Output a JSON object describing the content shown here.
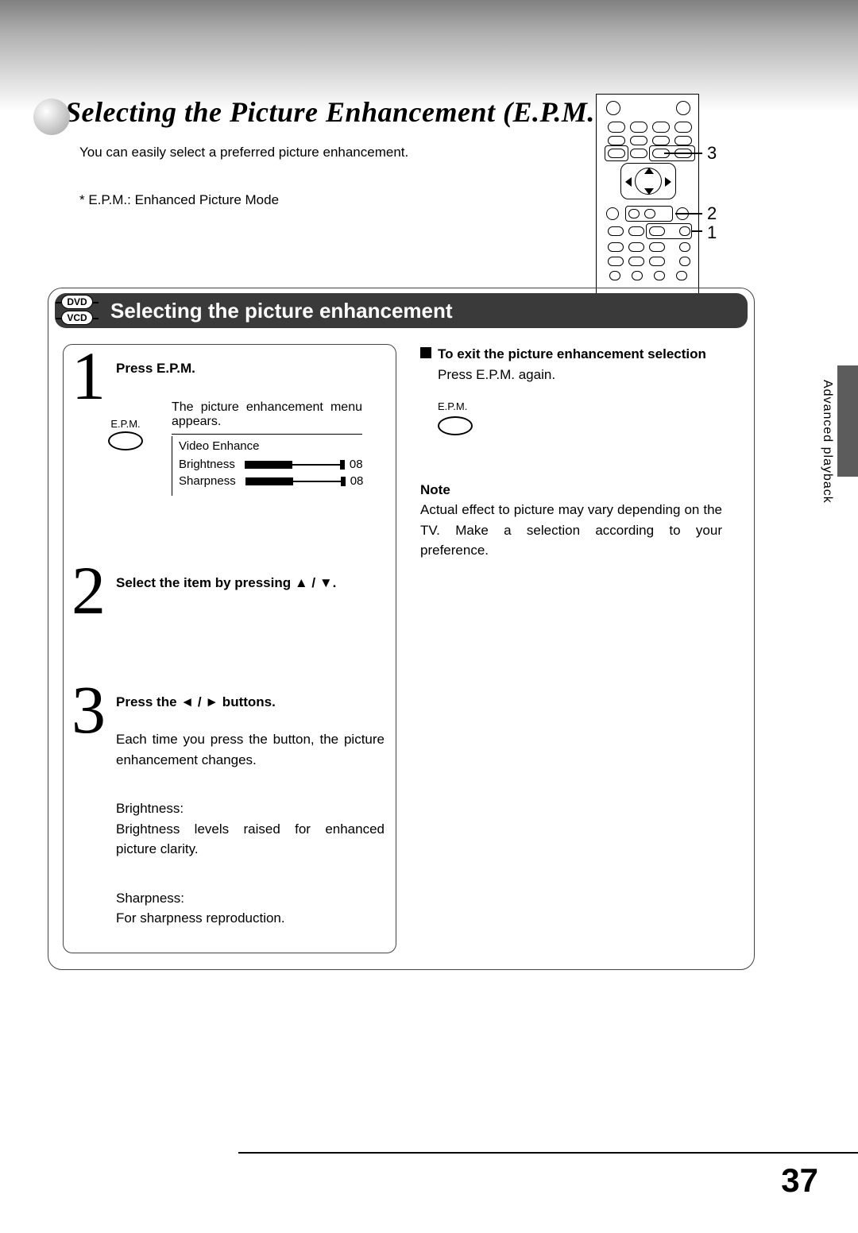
{
  "header": {
    "title": "Selecting the Picture Enhancement (E.P.M.*)",
    "intro": "You can easily select a preferred picture enhancement.",
    "footnote": "* E.P.M.: Enhanced Picture Mode"
  },
  "remote_callouts": [
    "3",
    "2",
    "1"
  ],
  "section": {
    "badges": [
      "DVD",
      "VCD"
    ],
    "title": "Selecting the picture enhancement",
    "steps": [
      {
        "num": "1",
        "title": "Press E.P.M.",
        "desc": "The picture enhancement menu appears.",
        "button_label": "E.P.M.",
        "osd": {
          "title": "Video Enhance",
          "rows": [
            {
              "label": "Brightness",
              "value": "08",
              "fill_pct": 50
            },
            {
              "label": "Sharpness",
              "value": "08",
              "fill_pct": 50
            }
          ]
        }
      },
      {
        "num": "2",
        "title": "Select the item by pressing ▲ / ▼."
      },
      {
        "num": "3",
        "title": "Press the ◄ / ► buttons.",
        "desc": "Each time you press the button, the picture enhancement changes.",
        "brightness_label": "Brightness:",
        "brightness_text": "Brightness levels raised for enhanced picture clarity.",
        "sharpness_label": "Sharpness:",
        "sharpness_text": "For sharpness reproduction."
      }
    ],
    "right": {
      "exit_title": "To exit the picture enhancement selection",
      "exit_text": "Press E.P.M. again.",
      "button_label": "E.P.M.",
      "note_head": "Note",
      "note_body": "Actual effect to picture may vary depending on the TV. Make a selection according to your preference."
    }
  },
  "side_label": "Advanced playback",
  "page_number": "37"
}
